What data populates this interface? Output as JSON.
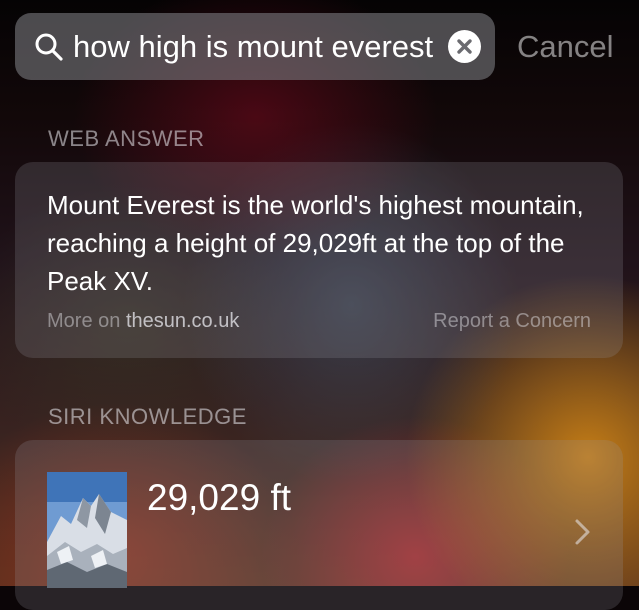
{
  "search": {
    "query": "how high is mount everest",
    "cancel_label": "Cancel",
    "search_icon": "search-icon",
    "clear_icon": "clear-icon"
  },
  "web_answer": {
    "section_title": "WEB ANSWER",
    "text": "Mount Everest is the world's highest mountain, reaching a height of 29,029ft at the top of the Peak XV.",
    "more_on_label": "More on",
    "source": "thesun.co.uk",
    "report_label": "Report a Concern"
  },
  "siri_knowledge": {
    "section_title": "SIRI KNOWLEDGE",
    "value": "29,029 ft",
    "thumbnail": "mountain-photo",
    "chevron_icon": "chevron-right-icon"
  },
  "colors": {
    "text_primary": "#ffffff",
    "text_secondary": "#8f8f94",
    "search_field": "#78787c",
    "card": "#96969f"
  }
}
